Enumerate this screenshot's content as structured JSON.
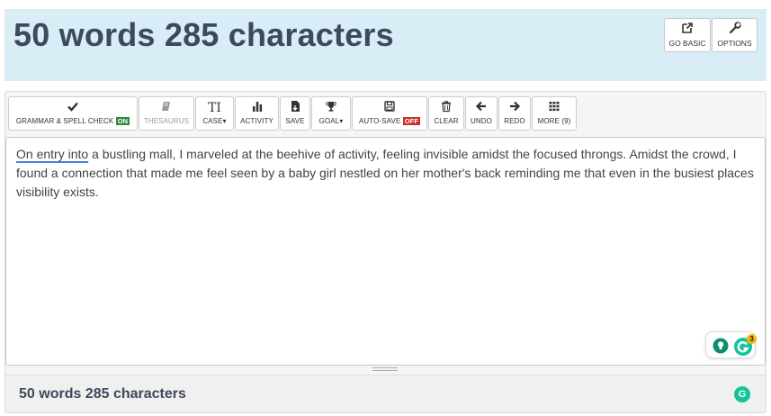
{
  "header": {
    "title": "50 words 285 characters",
    "go_basic_label": "GO BASIC",
    "options_label": "OPTIONS"
  },
  "toolbar": {
    "grammar_label": "GRAMMAR & SPELL CHECK",
    "grammar_state": "ON",
    "thesaurus_label": "THESAURUS",
    "case_label": "CASE",
    "activity_label": "ACTIVITY",
    "save_label": "SAVE",
    "goal_label": "GOAL",
    "autosave_label": "AUTO-SAVE",
    "autosave_state": "OFF",
    "clear_label": "CLEAR",
    "undo_label": "UNDO",
    "redo_label": "REDO",
    "more_label": "MORE (9)"
  },
  "editor": {
    "underlined_phrase": "On entry into",
    "text_rest": " a bustling mall, I marveled at the beehive of activity, feeling invisible amidst the focused throngs. Amidst the crowd, I found a connection that made me feel seen by a baby girl nestled on her mother's back reminding me that even in the busiest places visibility exists."
  },
  "grammarly": {
    "count": "3",
    "accent_color": "#15c39a"
  },
  "footer": {
    "stats": "50 words 285 characters",
    "g_letter": "G"
  },
  "colors": {
    "header_bg": "#d9edf7",
    "title_color": "#3b4a5c",
    "on_badge": "#2e8b3c",
    "off_badge": "#c9302c"
  }
}
